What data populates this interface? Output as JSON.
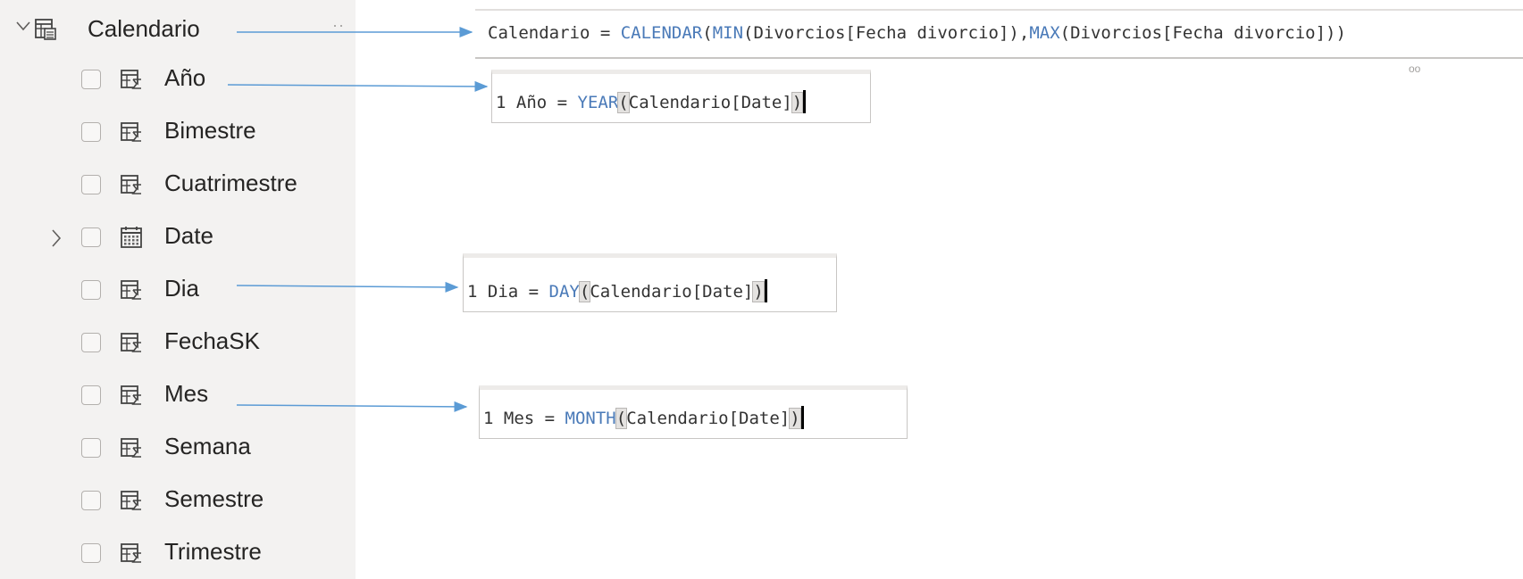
{
  "fields_pane": {
    "table": {
      "name": "Calendario",
      "more": "··"
    },
    "fields": [
      {
        "label": "Año",
        "icon": "calculated-column-icon"
      },
      {
        "label": "Bimestre",
        "icon": "calculated-column-icon"
      },
      {
        "label": "Cuatrimestre",
        "icon": "calculated-column-icon"
      },
      {
        "label": "Date",
        "icon": "calendar-hierarchy-icon"
      },
      {
        "label": "Dia",
        "icon": "calculated-column-icon"
      },
      {
        "label": "FechaSK",
        "icon": "calculated-column-icon"
      },
      {
        "label": "Mes",
        "icon": "calculated-column-icon"
      },
      {
        "label": "Semana",
        "icon": "calculated-column-icon"
      },
      {
        "label": "Semestre",
        "icon": "calculated-column-icon"
      },
      {
        "label": "Trimestre",
        "icon": "calculated-column-icon"
      }
    ]
  },
  "editors": {
    "calendario": {
      "lhs": "Calendario = ",
      "fn1": "CALENDAR",
      "p1": "(",
      "fn2": "MIN",
      "a1": "(Divorcios[Fecha divorcio]),",
      "fn3": "MAX",
      "a2": "(Divorcios[Fecha divorcio]))",
      "stray": "oo"
    },
    "anio": {
      "num": "1",
      "lhs": " Año = ",
      "fn": "YEAR",
      "open": "(",
      "arg": "Calendario[Date]",
      "close": ")"
    },
    "dia": {
      "num": "1",
      "lhs": " Dia = ",
      "fn": "DAY",
      "open": "(",
      "arg": "Calendario[Date]",
      "close": ")"
    },
    "mes": {
      "num": "1",
      "lhs": " Mes = ",
      "fn": "MONTH",
      "open": "(",
      "arg": "Calendario[Date]",
      "close": ")"
    }
  },
  "colors": {
    "arrow": "#5b9bd5",
    "keyword": "#4a7ab8",
    "pane_bg": "#f3f2f1"
  }
}
